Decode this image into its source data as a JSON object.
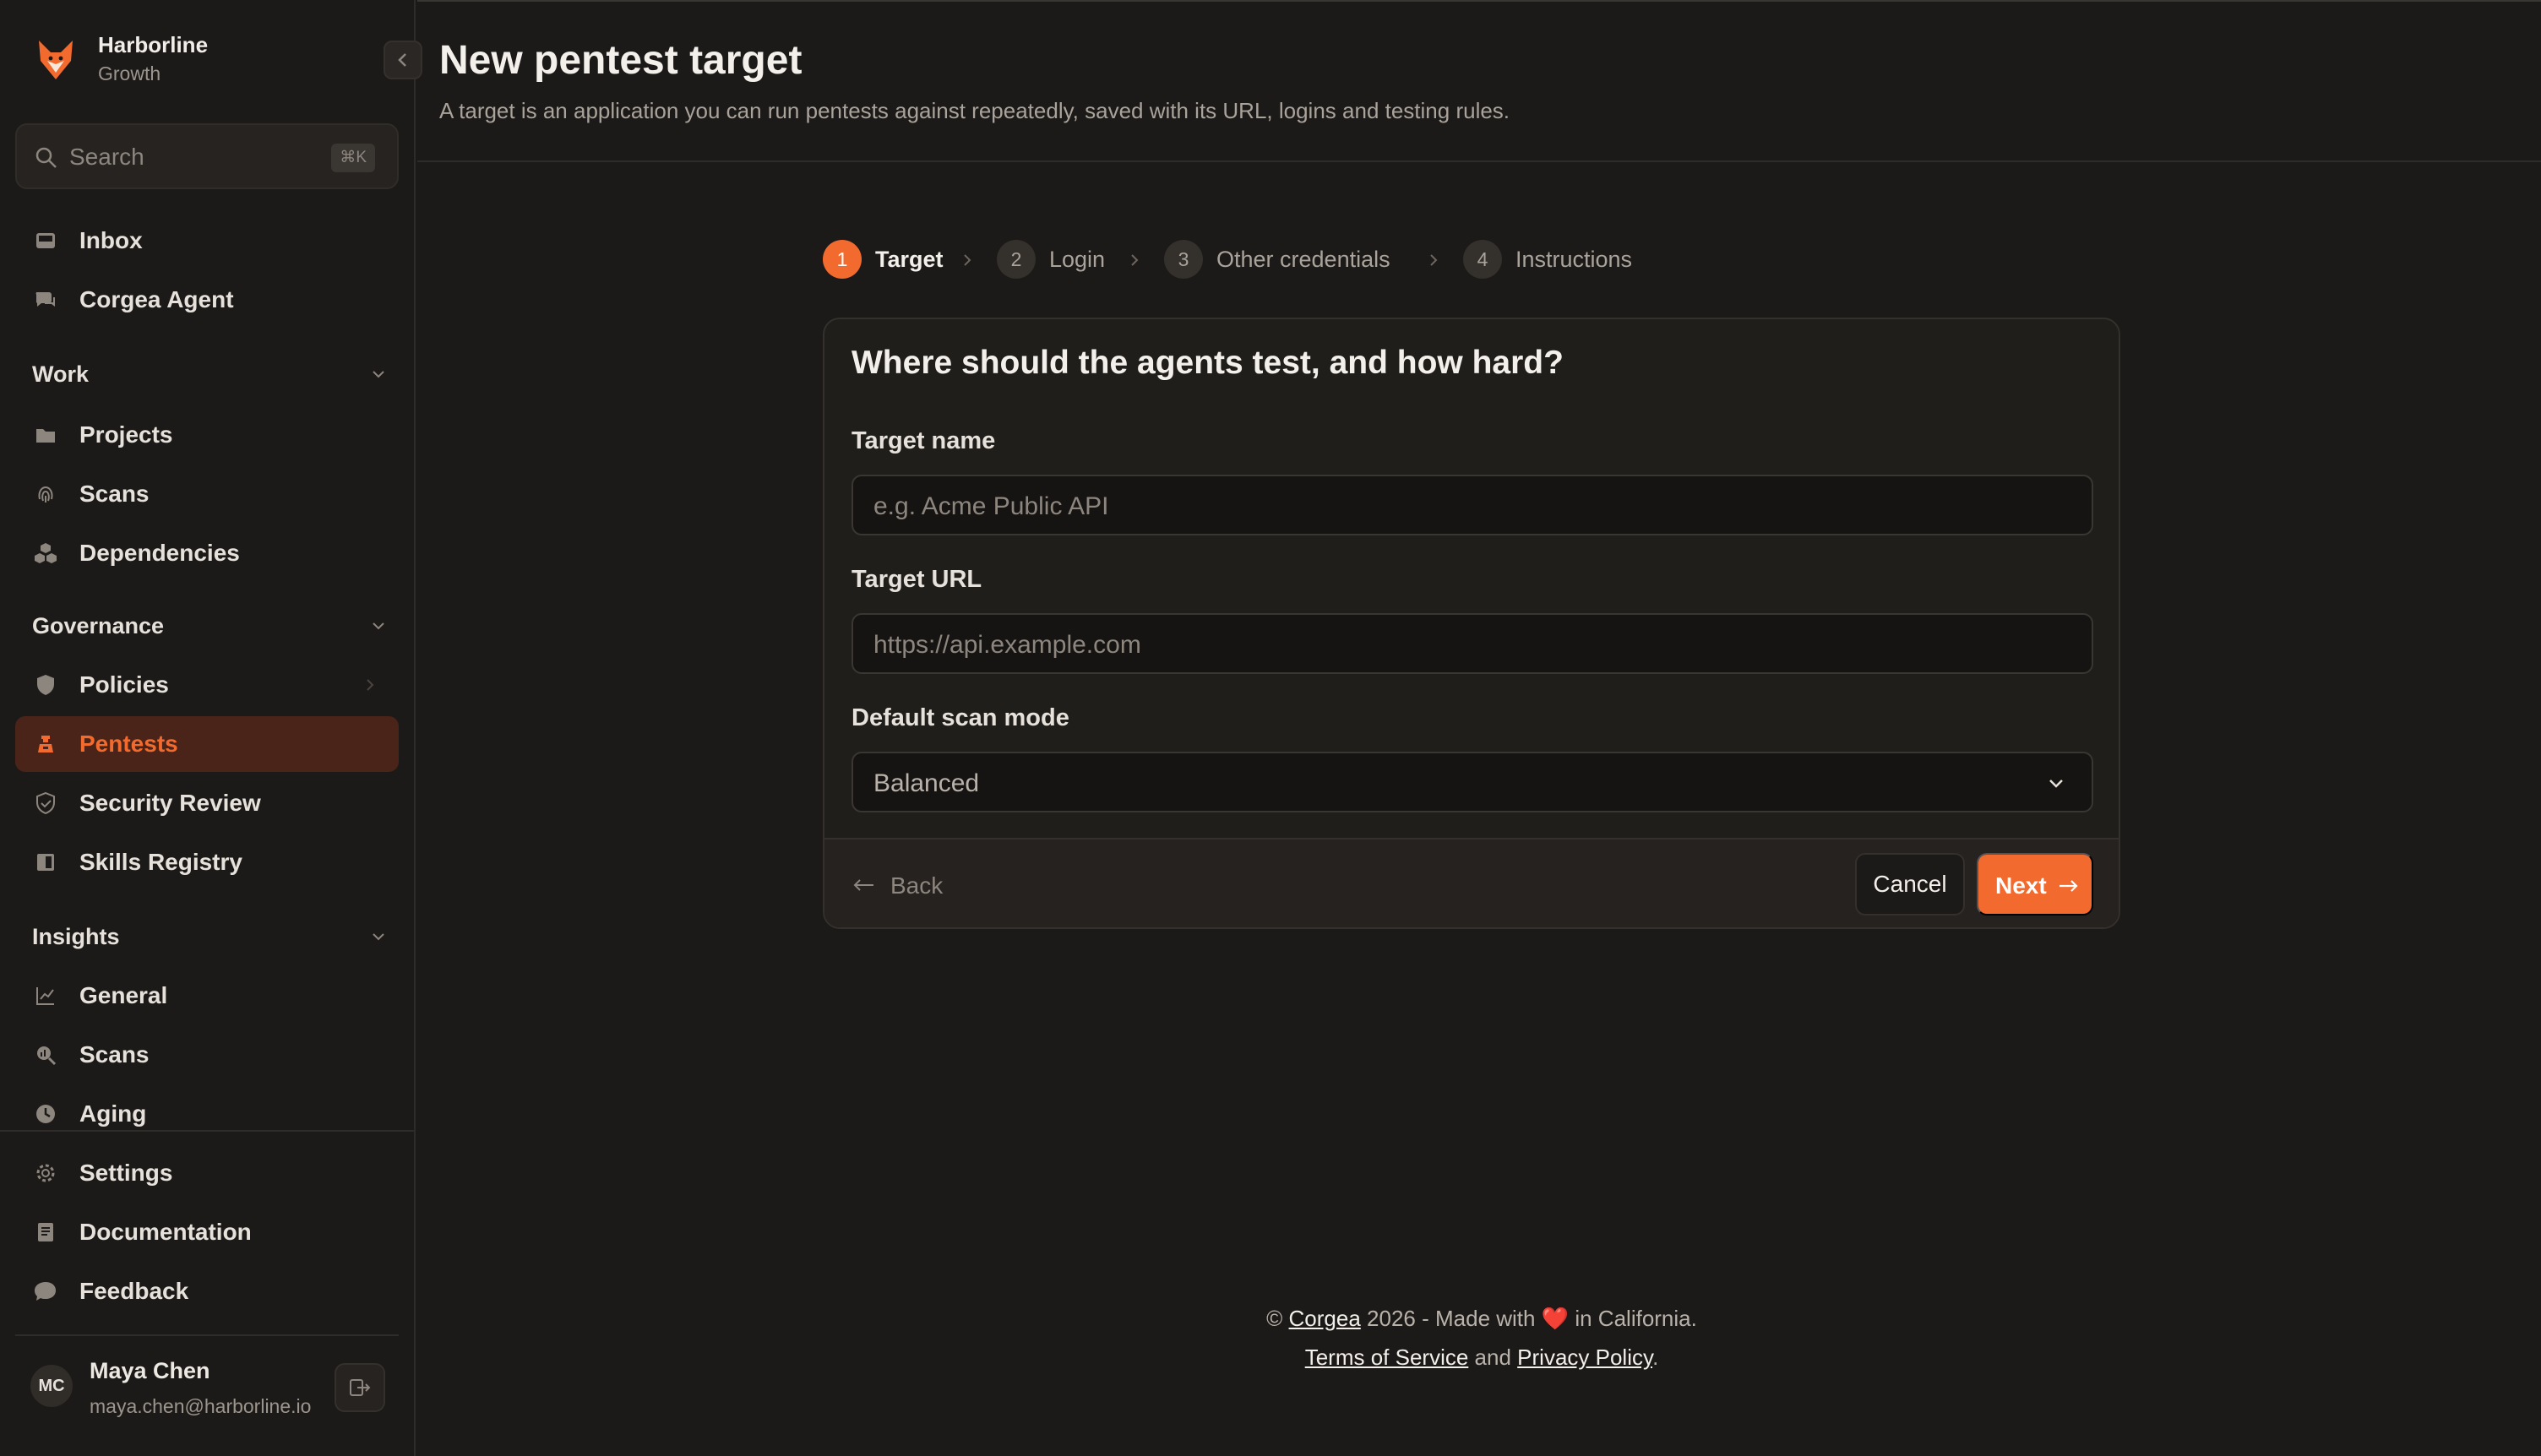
{
  "org": {
    "name": "Harborline",
    "plan": "Growth"
  },
  "search": {
    "placeholder": "Search",
    "shortcut": "⌘K"
  },
  "sidebar": {
    "top_items": [
      {
        "label": "Inbox",
        "icon": "inbox-icon"
      },
      {
        "label": "Corgea Agent",
        "icon": "chat-icon"
      }
    ],
    "sections": [
      {
        "label": "Work",
        "items": [
          {
            "label": "Projects",
            "icon": "folder-icon"
          },
          {
            "label": "Scans",
            "icon": "fingerprint-icon"
          },
          {
            "label": "Dependencies",
            "icon": "cubes-icon"
          }
        ]
      },
      {
        "label": "Governance",
        "items": [
          {
            "label": "Policies",
            "icon": "shield-icon"
          },
          {
            "label": "Pentests",
            "icon": "pentest-icon",
            "active": true
          },
          {
            "label": "Security Review",
            "icon": "shield-check-icon"
          },
          {
            "label": "Skills Registry",
            "icon": "book-icon"
          }
        ]
      },
      {
        "label": "Insights",
        "items": [
          {
            "label": "General",
            "icon": "chart-line-icon"
          },
          {
            "label": "Scans",
            "icon": "magnifier-chart-icon"
          },
          {
            "label": "Aging",
            "icon": "clock-icon"
          }
        ]
      }
    ],
    "bottom_items": [
      {
        "label": "Settings",
        "icon": "gear-icon"
      },
      {
        "label": "Documentation",
        "icon": "document-icon"
      },
      {
        "label": "Feedback",
        "icon": "speech-bubble-icon"
      }
    ]
  },
  "user": {
    "initials": "MC",
    "name": "Maya Chen",
    "email": "maya.chen@harborline.io"
  },
  "page": {
    "title": "New pentest target",
    "subtitle": "A target is an application you can run pentests against repeatedly, saved with its URL, logins and testing rules."
  },
  "stepper": [
    {
      "num": "1",
      "label": "Target",
      "active": true
    },
    {
      "num": "2",
      "label": "Login"
    },
    {
      "num": "3",
      "label": "Other credentials"
    },
    {
      "num": "4",
      "label": "Instructions"
    }
  ],
  "form": {
    "title": "Where should the agents test, and how hard?",
    "target_name": {
      "label": "Target name",
      "placeholder": "e.g. Acme Public API",
      "value": ""
    },
    "target_url": {
      "label": "Target URL",
      "placeholder": "https://api.example.com",
      "value": ""
    },
    "scan_mode": {
      "label": "Default scan mode",
      "value": "Balanced"
    },
    "back_label": "Back",
    "cancel_label": "Cancel",
    "next_label": "Next"
  },
  "footer": {
    "copyright_symbol": "©",
    "brand": "Corgea",
    "year_text": "2026 - Made with",
    "heart": "❤️",
    "location_text": "in California.",
    "terms": "Terms of Service",
    "and_text": "and",
    "privacy": "Privacy Policy",
    "period": "."
  },
  "colors": {
    "accent": "#f26a2e",
    "active_bg": "#4a2418",
    "background": "#1c1a18"
  }
}
